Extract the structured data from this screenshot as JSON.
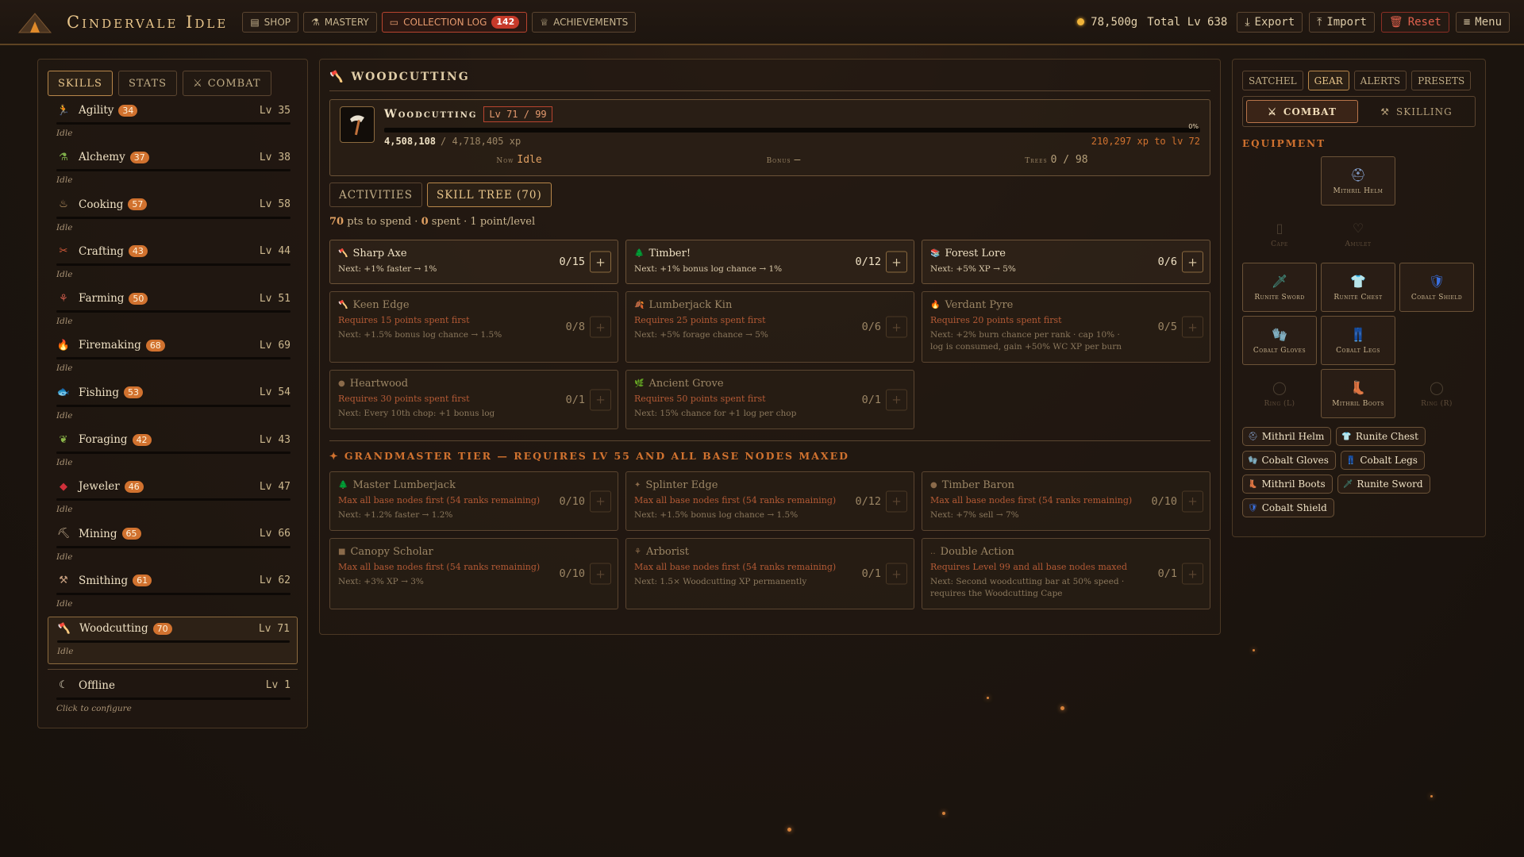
{
  "header": {
    "brand": "Cindervale Idle",
    "nav": [
      {
        "label": "SHOP",
        "icon": "store-icon"
      },
      {
        "label": "MASTERY",
        "icon": "flask-icon"
      },
      {
        "label": "COLLECTION LOG",
        "icon": "book-icon",
        "badge": "142"
      },
      {
        "label": "ACHIEVEMENTS",
        "icon": "trophy-icon"
      }
    ],
    "gold": "78,500g",
    "total_level": "Total Lv 638",
    "actions": [
      {
        "label": "Export",
        "icon": "download-icon"
      },
      {
        "label": "Import",
        "icon": "upload-icon"
      },
      {
        "label": "Reset",
        "icon": "trash-icon"
      },
      {
        "label": "Menu",
        "icon": "hamburger-icon"
      }
    ]
  },
  "sidebar": {
    "tabs": [
      "SKILLS",
      "STATS",
      "COMBAT"
    ],
    "skills": [
      {
        "name": "Agility",
        "badge": "34",
        "level": "Lv 35",
        "status": "Idle",
        "icon": "🏃",
        "color": "#d7703a"
      },
      {
        "name": "Alchemy",
        "badge": "37",
        "level": "Lv 38",
        "status": "Idle",
        "icon": "⚗",
        "color": "#7fae4a"
      },
      {
        "name": "Cooking",
        "badge": "57",
        "level": "Lv 58",
        "status": "Idle",
        "icon": "♨",
        "color": "#c9a06a"
      },
      {
        "name": "Crafting",
        "badge": "43",
        "level": "Lv 44",
        "status": "Idle",
        "icon": "✂",
        "color": "#d45a3a"
      },
      {
        "name": "Farming",
        "badge": "50",
        "level": "Lv 51",
        "status": "Idle",
        "icon": "⚘",
        "color": "#c85a4a"
      },
      {
        "name": "Firemaking",
        "badge": "68",
        "level": "Lv 69",
        "status": "Idle",
        "icon": "🔥",
        "color": "#f0a030"
      },
      {
        "name": "Fishing",
        "badge": "53",
        "level": "Lv 54",
        "status": "Idle",
        "icon": "🐟",
        "color": "#6ea0d0"
      },
      {
        "name": "Foraging",
        "badge": "42",
        "level": "Lv 43",
        "status": "Idle",
        "icon": "❦",
        "color": "#8ab448"
      },
      {
        "name": "Jeweler",
        "badge": "46",
        "level": "Lv 47",
        "status": "Idle",
        "icon": "◆",
        "color": "#d0303a"
      },
      {
        "name": "Mining",
        "badge": "65",
        "level": "Lv 66",
        "status": "Idle",
        "icon": "⛏",
        "color": "#c8b090"
      },
      {
        "name": "Smithing",
        "badge": "61",
        "level": "Lv 62",
        "status": "Idle",
        "icon": "⚒",
        "color": "#c8a080"
      },
      {
        "name": "Woodcutting",
        "badge": "70",
        "level": "Lv 71",
        "status": "Idle",
        "icon": "🪓",
        "color": "#d8c8b0"
      }
    ],
    "offline": {
      "name": "Offline",
      "level": "Lv 1",
      "status": "Click to configure"
    }
  },
  "main": {
    "title": "Woodcutting",
    "card": {
      "name": "Woodcutting",
      "level": "Lv 71 / 99",
      "xp_current": "4,508,108",
      "xp_max": "/ 4,718,405 xp",
      "xp_next": "210,297 xp to lv 72",
      "progress_pct": "0%",
      "progress": 0.0,
      "now_label": "Now",
      "now_value": "Idle",
      "bonus_label": "Bonus",
      "bonus_value": "—",
      "trees_label": "Trees",
      "trees_value": "0 / 98"
    },
    "subtabs": [
      "ACTIVITIES",
      "SKILL TREE (70)"
    ],
    "points_count": "70",
    "points_mid": "pts to spend ·",
    "points_spent": "0",
    "points_tail": "spent · 1 point/level",
    "nodes": [
      {
        "icon": "🪓",
        "name": "Sharp Axe",
        "req": "",
        "next": "Next: +1% faster → 1%",
        "count": "0/15",
        "open": true
      },
      {
        "icon": "🌲",
        "name": "Timber!",
        "req": "",
        "next": "Next: +1% bonus log chance → 1%",
        "count": "0/12",
        "open": true
      },
      {
        "icon": "📚",
        "name": "Forest Lore",
        "req": "",
        "next": "Next: +5% XP → 5%",
        "count": "0/6",
        "open": true
      },
      {
        "icon": "🪓",
        "name": "Keen Edge",
        "req": "Requires 15 points spent first",
        "next": "Next: +1.5% bonus log chance → 1.5%",
        "count": "0/8",
        "open": false
      },
      {
        "icon": "🍂",
        "name": "Lumberjack Kin",
        "req": "Requires 25 points spent first",
        "next": "Next: +5% forage chance → 5%",
        "count": "0/6",
        "open": false
      },
      {
        "icon": "🔥",
        "name": "Verdant Pyre",
        "req": "Requires 20 points spent first",
        "next": "Next: +2% burn chance per rank · cap 10% · log is consumed, gain +50% WC XP per burn",
        "count": "0/5",
        "open": false
      },
      {
        "icon": "●",
        "name": "Heartwood",
        "req": "Requires 30 points spent first",
        "next": "Next: Every 10th chop: +1 bonus log",
        "count": "0/1",
        "open": false
      },
      {
        "icon": "🌿",
        "name": "Ancient Grove",
        "req": "Requires 50 points spent first",
        "next": "Next: 15% chance for +1 log per chop",
        "count": "0/1",
        "open": false
      }
    ],
    "gm_header": "✦ GRANDMASTER TIER — REQUIRES LV 55 AND ALL BASE NODES MAXED",
    "gm_nodes": [
      {
        "icon": "🌲",
        "name": "Master Lumberjack",
        "req": "Max all base nodes first (54 ranks remaining)",
        "next": "Next: +1.2% faster → 1.2%",
        "count": "0/10"
      },
      {
        "icon": "✦",
        "name": "Splinter Edge",
        "req": "Max all base nodes first (54 ranks remaining)",
        "next": "Next: +1.5% bonus log chance → 1.5%",
        "count": "0/12"
      },
      {
        "icon": "●",
        "name": "Timber Baron",
        "req": "Max all base nodes first (54 ranks remaining)",
        "next": "Next: +7% sell → 7%",
        "count": "0/10"
      },
      {
        "icon": "■",
        "name": "Canopy Scholar",
        "req": "Max all base nodes first (54 ranks remaining)",
        "next": "Next: +3% XP → 3%",
        "count": "0/10"
      },
      {
        "icon": "⚘",
        "name": "Arborist",
        "req": "Max all base nodes first (54 ranks remaining)",
        "next": "Next: 1.5× Woodcutting XP permanently",
        "count": "0/1"
      },
      {
        "icon": "‥",
        "name": "Double Action",
        "req": "Requires Level 99 and all base nodes maxed",
        "next": "Next: Second woodcutting bar at 50% speed · requires the Woodcutting Cape",
        "count": "0/1"
      }
    ]
  },
  "right": {
    "tabs": [
      "SATCHEL",
      "GEAR",
      "ALERTS",
      "PRESETS"
    ],
    "modes": [
      "COMBAT",
      "SKILLING"
    ],
    "equipment_title": "EQUIPMENT",
    "slots": [
      {
        "label": "",
        "icon": "",
        "state": "none"
      },
      {
        "label": "Mithril Helm",
        "icon": "⛑",
        "color": "#8aa8d8",
        "state": "filled"
      },
      {
        "label": "",
        "icon": "",
        "state": "none"
      },
      {
        "label": "Cape",
        "icon": "▯",
        "color": "#c9b48e",
        "state": "empty"
      },
      {
        "label": "Amulet",
        "icon": "♡",
        "color": "#c9b48e",
        "state": "empty"
      },
      {
        "label": "",
        "icon": "",
        "state": "none"
      },
      {
        "label": "Runite Sword",
        "icon": "🗡",
        "color": "#4ab0a0",
        "state": "filled"
      },
      {
        "label": "Runite Chest",
        "icon": "👕",
        "color": "#3ab8a8",
        "state": "filled"
      },
      {
        "label": "Cobalt Shield",
        "icon": "🛡",
        "color": "#3a70e0",
        "state": "filled"
      },
      {
        "label": "Cobalt Gloves",
        "icon": "🧤",
        "color": "#3a6ae0",
        "state": "filled"
      },
      {
        "label": "Cobalt Legs",
        "icon": "👖",
        "color": "#3a6ae0",
        "state": "filled"
      },
      {
        "label": "",
        "icon": "",
        "state": "none"
      },
      {
        "label": "Ring (L)",
        "icon": "◯",
        "color": "#c9b48e",
        "state": "empty"
      },
      {
        "label": "Mithril Boots",
        "icon": "👢",
        "color": "#8aa8d8",
        "state": "filled"
      },
      {
        "label": "Ring (R)",
        "icon": "◯",
        "color": "#c9b48e",
        "state": "empty"
      }
    ],
    "chips": [
      {
        "label": "Mithril Helm",
        "icon": "⛑",
        "color": "#8aa8d8"
      },
      {
        "label": "Runite Chest",
        "icon": "👕",
        "color": "#3ab8a8"
      },
      {
        "label": "Cobalt Gloves",
        "icon": "🧤",
        "color": "#3a6ae0"
      },
      {
        "label": "Cobalt Legs",
        "icon": "👖",
        "color": "#3a6ae0"
      },
      {
        "label": "Mithril Boots",
        "icon": "👢",
        "color": "#8aa8d8"
      },
      {
        "label": "Runite Sword",
        "icon": "🗡",
        "color": "#4ab0a0"
      },
      {
        "label": "Cobalt Shield",
        "icon": "🛡",
        "color": "#3a70e0"
      }
    ]
  }
}
